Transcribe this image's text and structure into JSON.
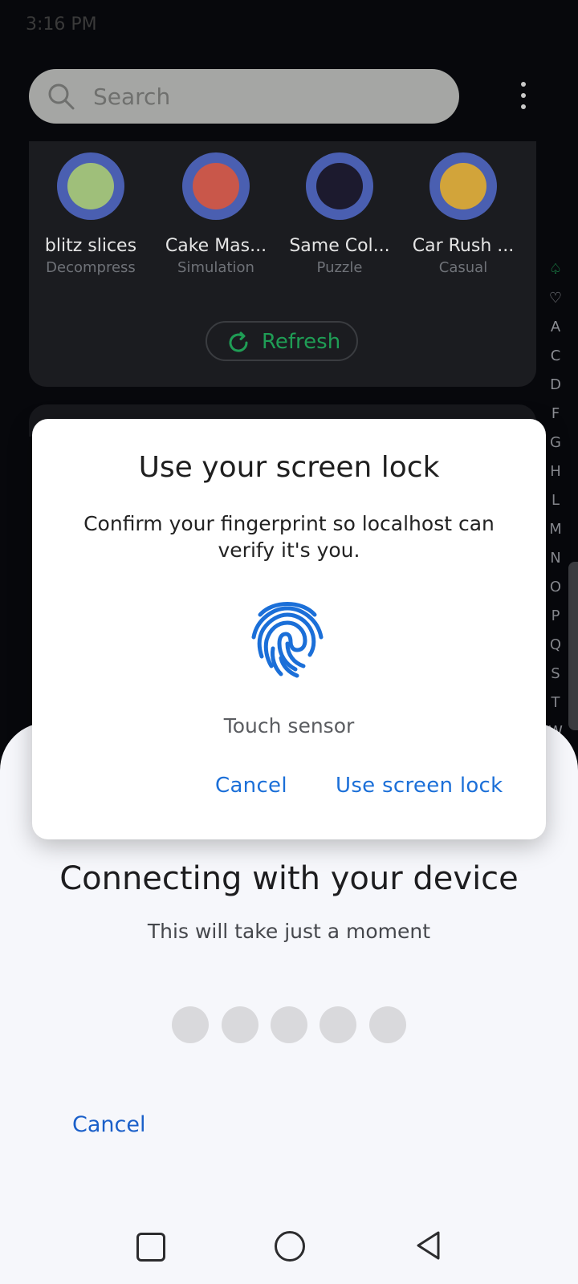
{
  "status_bar": {
    "time": "3:16 PM",
    "right": ""
  },
  "search": {
    "placeholder": "Search"
  },
  "apps": [
    {
      "name": "blitz slices",
      "category": "Decompress"
    },
    {
      "name": "Cake Mas...",
      "category": "Simulation"
    },
    {
      "name": "Same Col...",
      "category": "Puzzle"
    },
    {
      "name": "Car Rush ...",
      "category": "Casual"
    }
  ],
  "refresh_label": "Refresh",
  "alpha_index": [
    "♤",
    "♡",
    "A",
    "C",
    "D",
    "F",
    "G",
    "H",
    "L",
    "M",
    "N",
    "O",
    "P",
    "Q",
    "S",
    "T",
    "W"
  ],
  "sheet": {
    "title": "Connecting with your device",
    "subtitle": "This will take just a moment",
    "cancel": "Cancel"
  },
  "dialog": {
    "title": "Use your screen lock",
    "body": "Confirm your fingerprint so localhost can verify it's you.",
    "sensor_label": "Touch sensor",
    "cancel": "Cancel",
    "use_screen_lock": "Use screen lock"
  },
  "colors": {
    "accent_blue": "#1b6fd8",
    "refresh_green": "#1f9d55",
    "app_icon_ring": "#4a5fb1"
  }
}
